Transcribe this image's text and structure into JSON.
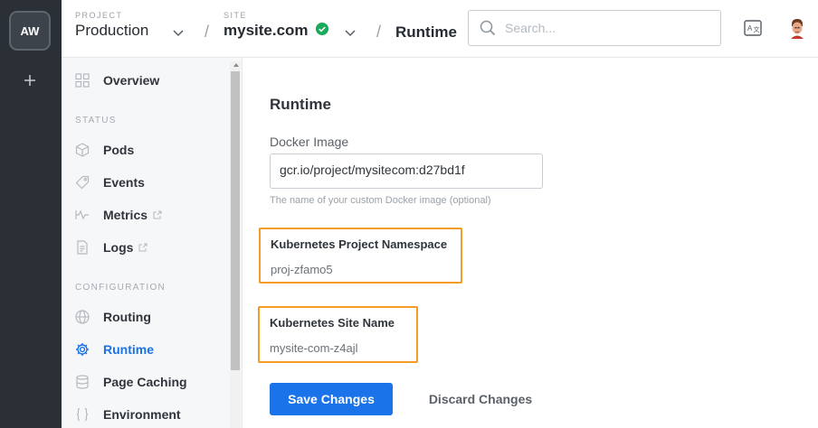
{
  "workspace": {
    "initials": "AW"
  },
  "header": {
    "project_caption": "PROJECT",
    "project_name": "Production",
    "site_caption": "SITE",
    "site_name": "mysite.com",
    "separator": "/",
    "page": "Runtime",
    "search_placeholder": "Search...",
    "site_status_color": "#1aa85a"
  },
  "sidebar": {
    "overview": "Overview",
    "status_section": "STATUS",
    "status_items": [
      "Pods",
      "Events",
      "Metrics",
      "Logs"
    ],
    "config_section": "CONFIGURATION",
    "config_items": [
      "Routing",
      "Runtime",
      "Page Caching",
      "Environment"
    ],
    "active_item": "Runtime"
  },
  "main": {
    "title": "Runtime",
    "docker_label": "Docker Image",
    "docker_value": "gcr.io/project/mysitecom:d27bd1f",
    "docker_help": "The name of your custom Docker image (optional)",
    "namespace_label": "Kubernetes Project Namespace",
    "namespace_value": "proj-zfamo5",
    "sitename_label": "Kubernetes Site Name",
    "sitename_value": "mysite-com-z4ajl",
    "save_label": "Save Changes",
    "discard_label": "Discard Changes"
  },
  "colors": {
    "accent": "#1a73e8",
    "highlight": "#f29b26",
    "rail": "#2b3037"
  }
}
